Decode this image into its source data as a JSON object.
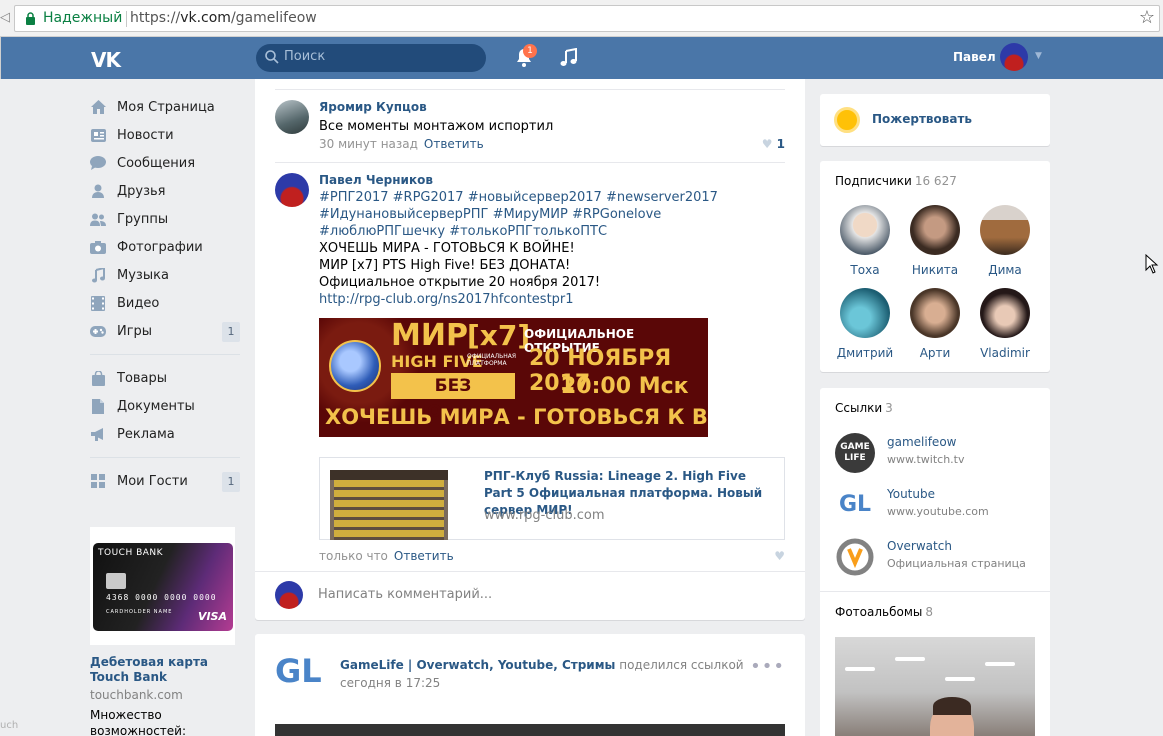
{
  "browser": {
    "secure_label": "Надежный",
    "url_prefix": "https://",
    "url_host": "vk.com",
    "url_path": "/gamelifeow"
  },
  "header": {
    "logo": "VK",
    "search_placeholder": "Поиск",
    "notifications_count": "1",
    "user_name": "Павел"
  },
  "left_menu": {
    "items": [
      {
        "label": "Моя Страница",
        "icon": "home-icon"
      },
      {
        "label": "Новости",
        "icon": "news-icon"
      },
      {
        "label": "Сообщения",
        "icon": "messages-icon"
      },
      {
        "label": "Друзья",
        "icon": "friends-icon"
      },
      {
        "label": "Группы",
        "icon": "groups-icon"
      },
      {
        "label": "Фотографии",
        "icon": "camera-icon"
      },
      {
        "label": "Музыка",
        "icon": "music-icon"
      },
      {
        "label": "Видео",
        "icon": "video-icon"
      },
      {
        "label": "Игры",
        "icon": "gamepad-icon",
        "count": "1"
      }
    ],
    "items2": [
      {
        "label": "Товары",
        "icon": "bag-icon"
      },
      {
        "label": "Документы",
        "icon": "document-icon"
      },
      {
        "label": "Реклама",
        "icon": "megaphone-icon"
      }
    ],
    "items3": [
      {
        "label": "Мои Гости",
        "icon": "apps-icon",
        "count": "1"
      }
    ]
  },
  "ad": {
    "card_bank": "TOUCH BANK",
    "card_number": "4368 0000 0000 0000",
    "card_holder": "CARDHOLDER NAME",
    "card_brand": "VISA",
    "title": "Дебетовая карта Touch Bank",
    "site": "touchbank.com",
    "text": "Множество возможностей: кэшбэк"
  },
  "feed": {
    "comment1": {
      "author": "Яромир Купцов",
      "text": "Все моменты монтажом испортил",
      "time": "30 минут назад",
      "reply": "Ответить",
      "likes": "1"
    },
    "comment2": {
      "author": "Павел Черников",
      "hashtags": "#РПГ2017 #RPG2017 #новыйсервер2017 #newserver2017 #ИдунановыйсерверРПГ #МируМИР #RPGonelove #люблюРПГшечку #толькоРПГтолькоПТС",
      "line1": "ХОЧЕШЬ МИРА - ГОТОВЬСЯ К ВОЙНЕ!",
      "line2": "МИР [x7] PTS High Five! БЕЗ ДОНАТА!",
      "line3": "Официальное открытие 20 ноября 2017!",
      "link": "http://rpg-club.org/ns2017hfcontestpr1",
      "banner": {
        "mir": "МИР",
        "x7": "[x7]",
        "hf": "HIGH FIVE",
        "hfsub": "ОФИЦИАЛЬНАЯ ПЛАТФОРМА",
        "bez": "БЕЗ ДОНАТА",
        "offic": "ОФИЦИАЛЬНОЕ ОТКРЫТИЕ",
        "date": "20 НОЯБРЯ 2017",
        "time": "20:00 Мск",
        "war": "ХОЧЕШЬ МИРА - ГОТОВЬСЯ К ВОЙНЕ"
      },
      "card_title": "РПГ-Клуб Russia: Lineage 2. High Five Part 5 Официальная платформа. Новый сервер МИР!",
      "card_site": "www.rpg-club.com",
      "time": "только что",
      "reply": "Ответить"
    },
    "comment_placeholder": "Написать комментарий...",
    "post2": {
      "logo": "GL",
      "author": "GameLife | Overwatch, Youtube, Стримы",
      "action": "поделился ссылкой",
      "time": "сегодня в 17:25"
    }
  },
  "right": {
    "donate": "Пожертвовать",
    "subscribers_title": "Подписчики",
    "subscribers_count": "16 627",
    "subscribers": [
      {
        "name": "Тоха",
        "color": "#d9c9b8"
      },
      {
        "name": "Никита",
        "color": "#5a4a3e"
      },
      {
        "name": "Дима",
        "color": "#8a5a3a"
      },
      {
        "name": "Дмитрий",
        "color": "#2c7a8c"
      },
      {
        "name": "Арти",
        "color": "#6a5040"
      },
      {
        "name": "Vladimir",
        "color": "#3a2a28"
      }
    ],
    "links_title": "Ссылки",
    "links_count": "3",
    "links": [
      {
        "name": "gamelifeow",
        "sub": "www.twitch.tv"
      },
      {
        "name": "Youtube",
        "sub": "www.youtube.com"
      },
      {
        "name": "Overwatch",
        "sub": "Официальная страница"
      }
    ],
    "albums_title": "Фотоальбомы",
    "albums_count": "8"
  },
  "status_text": "uch"
}
